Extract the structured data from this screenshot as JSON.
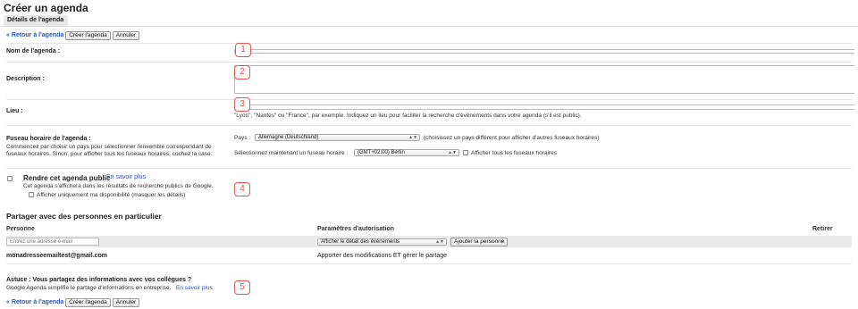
{
  "page": {
    "title": "Créer un agenda",
    "tab_label": "Détails de l'agenda"
  },
  "toolbar": {
    "back_link": "« Retour à l'agenda",
    "create_label": "Créer l'agenda",
    "cancel_label": "Annuler"
  },
  "fields": {
    "name_label": "Nom de l'agenda :",
    "description_label": "Description :",
    "location_label": "Lieu :",
    "location_hint": "\"Lyon\", \"Nantes\" ou \"France\", par exemple. Indiquez un lieu pour faciliter la recherche d'événements dans votre agenda (s'il est public)."
  },
  "timezone": {
    "label": "Fuseau horaire de l'agenda :",
    "description": "Commencez par choisir un pays pour sélectionner l'ensemble correspondant de fuseaux horaires. Sinon, pour afficher tous les fuseaux horaires, cochez la case.",
    "country_label": "Pays :",
    "country_value": "Allemagne (Deutschland)",
    "country_note": "(choisissez un pays différent pour afficher d'autres fuseaux horaires)",
    "zone_label": "Sélectionnez maintenant un fuseau horaire :",
    "zone_value": "(GMT+02:00) Berlin",
    "show_all_label": "Afficher tous les fuseaux horaires"
  },
  "public": {
    "title": "Rendre cet agenda public",
    "learn_more": "En savoir plus",
    "description": "Cet agenda s'affichera dans les résultats de recherche publics de Google.",
    "availability_label": "Afficher uniquement ma disponibilité (masquer les détails)"
  },
  "sharing": {
    "title": "Partager avec des personnes en particulier",
    "col_person": "Personne",
    "col_permissions": "Paramètres d'autorisation",
    "col_remove": "Retirer",
    "email_placeholder": "Entrez une adresse e-mail",
    "permission_value": "Afficher le détail des événements",
    "add_button": "Ajouter la personne",
    "rows": [
      {
        "email": "monadresseemailtest@gmail.com",
        "permission": "Apporter des modifications ET gérer le partage"
      }
    ]
  },
  "tip": {
    "title": "Astuce : Vous partagez des informations avec vos collègues ?",
    "text": "Google Agenda simplifie le partage d'informations en entreprise.",
    "learn_more": "En savoir plus"
  },
  "badges": [
    "1",
    "2",
    "3",
    "4",
    "5"
  ],
  "colors": {
    "link": "#2255cc",
    "badge": "#e8534a"
  }
}
